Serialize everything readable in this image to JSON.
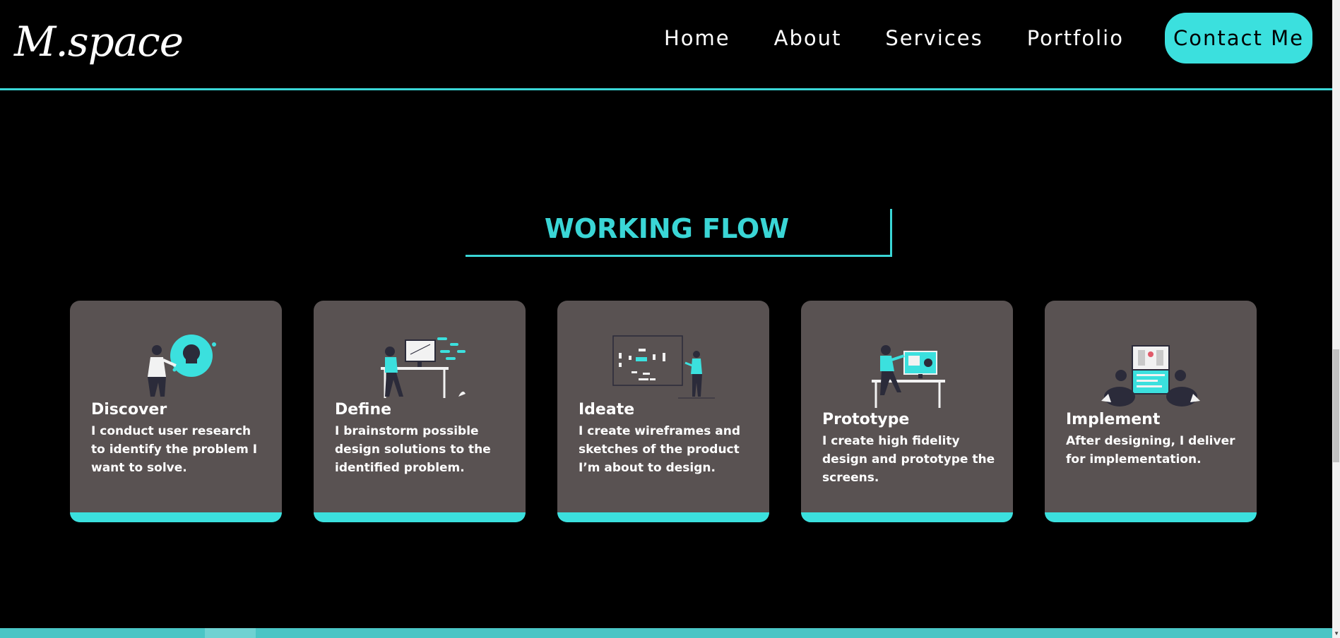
{
  "header": {
    "logo_text": "M.space",
    "nav": [
      "Home",
      "About",
      "Services",
      "Portfolio"
    ],
    "contact_label": "Contact Me"
  },
  "section": {
    "title": "WORKING FLOW"
  },
  "cards": [
    {
      "title": "Discover",
      "text": "I conduct user research to identify the problem I want to solve."
    },
    {
      "title": "Define",
      "text": "I brainstorm possible design solutions to the identified problem."
    },
    {
      "title": "Ideate",
      "text": "I create wireframes and sketches of the product I’m about to design."
    },
    {
      "title": "Prototype",
      "text": "I create high fidelity design and prototype the screens."
    },
    {
      "title": "Implement",
      "text": "After designing, I deliver for implementation."
    }
  ],
  "colors": {
    "accent": "#3be0de",
    "card_bg": "#595252",
    "background": "#000000"
  }
}
